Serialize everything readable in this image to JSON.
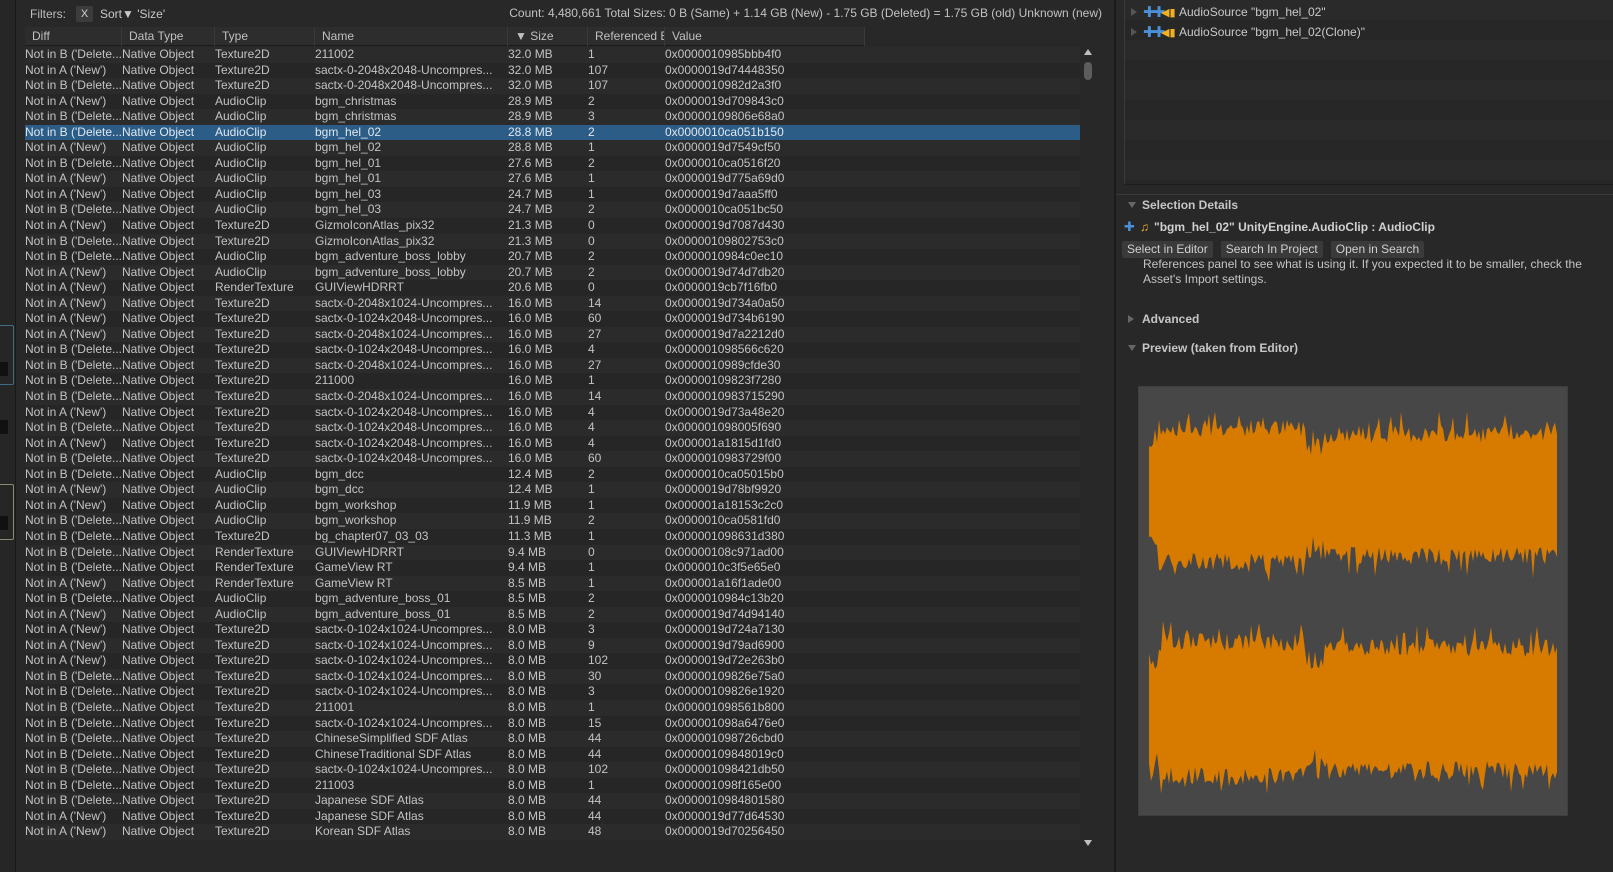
{
  "filter_bar": {
    "filters_label": "Filters:",
    "clear_filter_label": "X",
    "sort_label": "Sort▼ 'Size'",
    "summary": "Count: 4,480,661   Total Sizes: 0 B (Same) + 1.14 GB (New) - 1.75 GB (Deleted) = 1.75 GB (old) Unknown (new)"
  },
  "table": {
    "columns": [
      "Diff",
      "Data Type",
      "Type",
      "Name",
      "▼ Size",
      "Referenced B",
      "Value"
    ],
    "selected_index": 5,
    "rows": [
      [
        "Not in B ('Delete...",
        "Native Object",
        "Texture2D",
        "211002",
        "32.0 MB",
        "1",
        "0x0000010985bbb4f0"
      ],
      [
        "Not in A ('New')",
        "Native Object",
        "Texture2D",
        "sactx-0-2048x2048-Uncompres...",
        "32.0 MB",
        "107",
        "0x0000019d74448350"
      ],
      [
        "Not in B ('Delete...",
        "Native Object",
        "Texture2D",
        "sactx-0-2048x2048-Uncompres...",
        "32.0 MB",
        "107",
        "0x0000010982d2a3f0"
      ],
      [
        "Not in A ('New')",
        "Native Object",
        "AudioClip",
        "bgm_christmas",
        "28.9 MB",
        "2",
        "0x0000019d709843c0"
      ],
      [
        "Not in B ('Delete...",
        "Native Object",
        "AudioClip",
        "bgm_christmas",
        "28.9 MB",
        "3",
        "0x00000109806e68a0"
      ],
      [
        "Not in B ('Delete...",
        "Native Object",
        "AudioClip",
        "bgm_hel_02",
        "28.8 MB",
        "2",
        "0x0000010ca051b150"
      ],
      [
        "Not in A ('New')",
        "Native Object",
        "AudioClip",
        "bgm_hel_02",
        "28.8 MB",
        "1",
        "0x0000019d7549cf50"
      ],
      [
        "Not in B ('Delete...",
        "Native Object",
        "AudioClip",
        "bgm_hel_01",
        "27.6 MB",
        "2",
        "0x0000010ca0516f20"
      ],
      [
        "Not in A ('New')",
        "Native Object",
        "AudioClip",
        "bgm_hel_01",
        "27.6 MB",
        "1",
        "0x0000019d775a69d0"
      ],
      [
        "Not in A ('New')",
        "Native Object",
        "AudioClip",
        "bgm_hel_03",
        "24.7 MB",
        "1",
        "0x0000019d7aaa5ff0"
      ],
      [
        "Not in B ('Delete...",
        "Native Object",
        "AudioClip",
        "bgm_hel_03",
        "24.7 MB",
        "2",
        "0x0000010ca051bc50"
      ],
      [
        "Not in A ('New')",
        "Native Object",
        "Texture2D",
        "GizmoIconAtlas_pix32",
        "21.3 MB",
        "0",
        "0x0000019d7087d430"
      ],
      [
        "Not in B ('Delete...",
        "Native Object",
        "Texture2D",
        "GizmoIconAtlas_pix32",
        "21.3 MB",
        "0",
        "0x00000109802753c0"
      ],
      [
        "Not in B ('Delete...",
        "Native Object",
        "AudioClip",
        "bgm_adventure_boss_lobby",
        "20.7 MB",
        "2",
        "0x0000010984c0ec10"
      ],
      [
        "Not in A ('New')",
        "Native Object",
        "AudioClip",
        "bgm_adventure_boss_lobby",
        "20.7 MB",
        "2",
        "0x0000019d74d7db20"
      ],
      [
        "Not in A ('New')",
        "Native Object",
        "RenderTexture",
        "GUIViewHDRRT",
        "20.6 MB",
        "0",
        "0x0000019cb7f16fb0"
      ],
      [
        "Not in A ('New')",
        "Native Object",
        "Texture2D",
        "sactx-0-2048x1024-Uncompres...",
        "16.0 MB",
        "14",
        "0x0000019d734a0a50"
      ],
      [
        "Not in A ('New')",
        "Native Object",
        "Texture2D",
        "sactx-0-1024x2048-Uncompres...",
        "16.0 MB",
        "60",
        "0x0000019d734b6190"
      ],
      [
        "Not in A ('New')",
        "Native Object",
        "Texture2D",
        "sactx-0-2048x1024-Uncompres...",
        "16.0 MB",
        "27",
        "0x0000019d7a2212d0"
      ],
      [
        "Not in B ('Delete...",
        "Native Object",
        "Texture2D",
        "sactx-0-1024x2048-Uncompres...",
        "16.0 MB",
        "4",
        "0x000001098566c620"
      ],
      [
        "Not in B ('Delete...",
        "Native Object",
        "Texture2D",
        "sactx-0-2048x1024-Uncompres...",
        "16.0 MB",
        "27",
        "0x0000010989cfde30"
      ],
      [
        "Not in B ('Delete...",
        "Native Object",
        "Texture2D",
        "211000",
        "16.0 MB",
        "1",
        "0x00000109823f7280"
      ],
      [
        "Not in B ('Delete...",
        "Native Object",
        "Texture2D",
        "sactx-0-2048x1024-Uncompres...",
        "16.0 MB",
        "14",
        "0x0000010983715290"
      ],
      [
        "Not in A ('New')",
        "Native Object",
        "Texture2D",
        "sactx-0-1024x2048-Uncompres...",
        "16.0 MB",
        "4",
        "0x0000019d73a48e20"
      ],
      [
        "Not in B ('Delete...",
        "Native Object",
        "Texture2D",
        "sactx-0-1024x2048-Uncompres...",
        "16.0 MB",
        "4",
        "0x000001098005f690"
      ],
      [
        "Not in A ('New')",
        "Native Object",
        "Texture2D",
        "sactx-0-1024x2048-Uncompres...",
        "16.0 MB",
        "4",
        "0x000001a1815d1fd0"
      ],
      [
        "Not in B ('Delete...",
        "Native Object",
        "Texture2D",
        "sactx-0-1024x2048-Uncompres...",
        "16.0 MB",
        "60",
        "0x0000010983729f00"
      ],
      [
        "Not in B ('Delete...",
        "Native Object",
        "AudioClip",
        "bgm_dcc",
        "12.4 MB",
        "2",
        "0x0000010ca05015b0"
      ],
      [
        "Not in A ('New')",
        "Native Object",
        "AudioClip",
        "bgm_dcc",
        "12.4 MB",
        "1",
        "0x0000019d78bf9920"
      ],
      [
        "Not in A ('New')",
        "Native Object",
        "AudioClip",
        "bgm_workshop",
        "11.9 MB",
        "1",
        "0x000001a18153c2c0"
      ],
      [
        "Not in B ('Delete...",
        "Native Object",
        "AudioClip",
        "bgm_workshop",
        "11.9 MB",
        "2",
        "0x0000010ca0581fd0"
      ],
      [
        "Not in B ('Delete...",
        "Native Object",
        "Texture2D",
        "bg_chapter07_03_03",
        "11.3 MB",
        "1",
        "0x000001098631d380"
      ],
      [
        "Not in B ('Delete...",
        "Native Object",
        "RenderTexture",
        "GUIViewHDRRT",
        "9.4 MB",
        "0",
        "0x00000108c971ad00"
      ],
      [
        "Not in B ('Delete...",
        "Native Object",
        "RenderTexture",
        "GameView RT",
        "9.4 MB",
        "1",
        "0x0000010c3f5e65e0"
      ],
      [
        "Not in A ('New')",
        "Native Object",
        "RenderTexture",
        "GameView RT",
        "8.5 MB",
        "1",
        "0x000001a16f1ade00"
      ],
      [
        "Not in B ('Delete...",
        "Native Object",
        "AudioClip",
        "bgm_adventure_boss_01",
        "8.5 MB",
        "2",
        "0x0000010984c13b20"
      ],
      [
        "Not in A ('New')",
        "Native Object",
        "AudioClip",
        "bgm_adventure_boss_01",
        "8.5 MB",
        "2",
        "0x0000019d74d94140"
      ],
      [
        "Not in A ('New')",
        "Native Object",
        "Texture2D",
        "sactx-0-1024x1024-Uncompres...",
        "8.0 MB",
        "3",
        "0x0000019d724a7130"
      ],
      [
        "Not in A ('New')",
        "Native Object",
        "Texture2D",
        "sactx-0-1024x1024-Uncompres...",
        "8.0 MB",
        "9",
        "0x0000019d79ad6900"
      ],
      [
        "Not in A ('New')",
        "Native Object",
        "Texture2D",
        "sactx-0-1024x1024-Uncompres...",
        "8.0 MB",
        "102",
        "0x0000019d72e263b0"
      ],
      [
        "Not in B ('Delete...",
        "Native Object",
        "Texture2D",
        "sactx-0-1024x1024-Uncompres...",
        "8.0 MB",
        "30",
        "0x00000109826e75a0"
      ],
      [
        "Not in B ('Delete...",
        "Native Object",
        "Texture2D",
        "sactx-0-1024x1024-Uncompres...",
        "8.0 MB",
        "3",
        "0x00000109826e1920"
      ],
      [
        "Not in B ('Delete...",
        "Native Object",
        "Texture2D",
        "211001",
        "8.0 MB",
        "1",
        "0x000001098561b800"
      ],
      [
        "Not in B ('Delete...",
        "Native Object",
        "Texture2D",
        "sactx-0-1024x1024-Uncompres...",
        "8.0 MB",
        "15",
        "0x000001098a6476e0"
      ],
      [
        "Not in B ('Delete...",
        "Native Object",
        "Texture2D",
        "ChineseSimplified SDF Atlas",
        "8.0 MB",
        "44",
        "0x000001098726cbd0"
      ],
      [
        "Not in B ('Delete...",
        "Native Object",
        "Texture2D",
        "ChineseTraditional SDF Atlas",
        "8.0 MB",
        "44",
        "0x00000109848019c0"
      ],
      [
        "Not in B ('Delete...",
        "Native Object",
        "Texture2D",
        "sactx-0-1024x1024-Uncompres...",
        "8.0 MB",
        "102",
        "0x000001098421db50"
      ],
      [
        "Not in B ('Delete...",
        "Native Object",
        "Texture2D",
        "211003",
        "8.0 MB",
        "1",
        "0x000001098f165e00"
      ],
      [
        "Not in B ('Delete...",
        "Native Object",
        "Texture2D",
        "Japanese SDF Atlas",
        "8.0 MB",
        "44",
        "0x0000010984801580"
      ],
      [
        "Not in A ('New')",
        "Native Object",
        "Texture2D",
        "Japanese SDF Atlas",
        "8.0 MB",
        "44",
        "0x0000019d77d64530"
      ],
      [
        "Not in A ('New')",
        "Native Object",
        "Texture2D",
        "Korean SDF Atlas",
        "8.0 MB",
        "48",
        "0x0000019d70256450"
      ]
    ]
  },
  "references": {
    "items": [
      {
        "label": "AudioSource \"bgm_hel_02\"",
        "icon": "audio-source-icon"
      },
      {
        "label": "AudioSource \"bgm_hel_02(Clone)\"",
        "icon": "audio-source-icon"
      }
    ]
  },
  "selection_details": {
    "header": "Selection Details",
    "title": "\"bgm_hel_02\" UnityEngine.AudioClip : AudioClip",
    "buttons": [
      "Select in Editor",
      "Search In Project",
      "Open in Search"
    ],
    "description": "References panel to see what is using it. If you expected it to be smaller, check the Asset's Import settings."
  },
  "advanced": {
    "header": "Advanced"
  },
  "preview": {
    "header": "Preview (taken from Editor)",
    "waveform_color": "#d67a00",
    "background_color": "#474747"
  },
  "colors": {
    "selected_row": "#2c5d87",
    "accent_blue": "#4a90d9",
    "accent_yellow": "#f0b020"
  }
}
